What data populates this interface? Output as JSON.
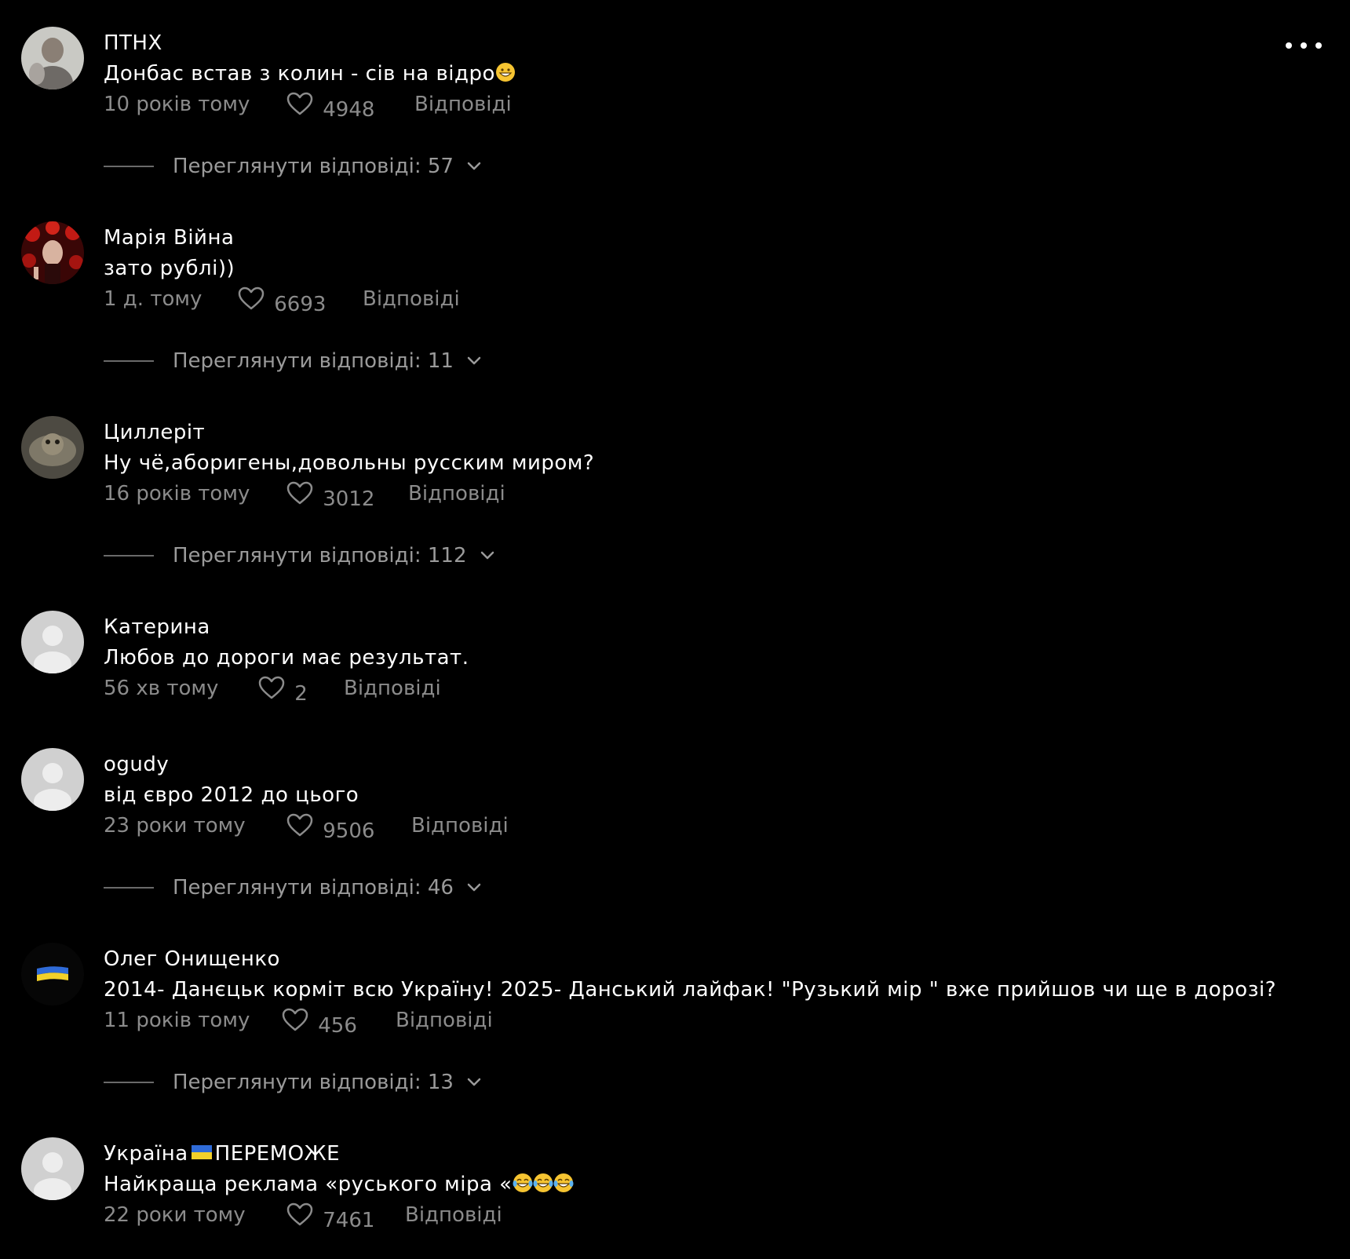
{
  "ui": {
    "more_label": "more-options",
    "reply_label": "Відповіді",
    "view_replies_prefix": "Переглянути відповіді:"
  },
  "colors": {
    "background": "#000000",
    "text": "#ffffff",
    "muted": "#8b8b8b"
  },
  "comments": [
    {
      "author": "ПТНХ",
      "text": "Донбас встав з колин - сів на відро",
      "text_emoji": "grinning-face",
      "time": "10 років тому",
      "likes": "4948",
      "replies_label": "Переглянути відповіді: 57",
      "avatar": "photo-man"
    },
    {
      "author": "Марія Війна",
      "text": "зато рублі))",
      "time": "1 д. тому",
      "likes": "6693",
      "replies_label": "Переглянути відповіді: 11",
      "avatar": "photo-woman-red"
    },
    {
      "author": "Циллеріт",
      "text": "Ну чё,аборигены,довольны русским миром?",
      "time": "16 років тому",
      "likes": "3012",
      "replies_label": "Переглянути відповіді: 112",
      "avatar": "photo-moth"
    },
    {
      "author": "Катерина",
      "text": "Любов до дороги має результат.",
      "time": "56 хв тому",
      "likes": "2",
      "avatar": "default-user"
    },
    {
      "author": "ogudy",
      "text": "від євро 2012 до цього",
      "time": "23 роки тому",
      "likes": "9506",
      "replies_label": "Переглянути відповіді: 46",
      "avatar": "default-user"
    },
    {
      "author": "Олег Онищенко",
      "text": "2014- Данєцьк корміт всю Україну! 2025- Данський лайфак! \"Рузький мір \" вже прийшов чи ще в дорозі?",
      "time": "11 років тому",
      "likes": "456",
      "replies_label": "Переглянути відповіді: 13",
      "avatar": "ukraine-flag"
    },
    {
      "author_part1": "Україна",
      "author_part2": "ПЕРЕМОЖЕ",
      "text": "Найкраща реклама «руського міра «",
      "text_emoji": "tears-of-joy x3",
      "time": "22 роки тому",
      "likes": "7461",
      "avatar": "default-user"
    }
  ]
}
